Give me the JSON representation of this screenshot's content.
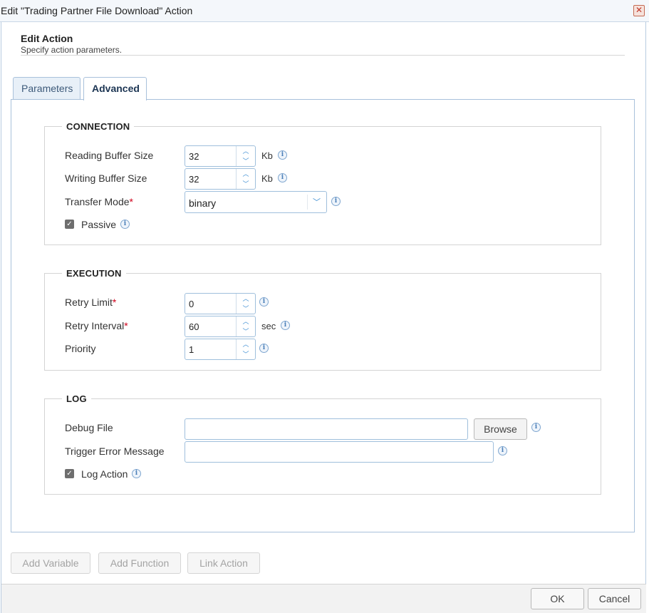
{
  "window": {
    "title": "Edit \"Trading Partner File Download\" Action",
    "close_glyph": "✕",
    "close_icon": "close-icon"
  },
  "header": {
    "title": "Edit Action",
    "subtitle": "Specify action parameters."
  },
  "tabs": [
    {
      "label": "Parameters",
      "active": false
    },
    {
      "label": "Advanced",
      "active": true
    }
  ],
  "connection": {
    "legend": "CONNECTION",
    "reading_buffer": {
      "label": "Reading Buffer Size",
      "value": "32",
      "unit": "Kb"
    },
    "writing_buffer": {
      "label": "Writing Buffer Size",
      "value": "32",
      "unit": "Kb"
    },
    "transfer_mode": {
      "label": "Transfer Mode",
      "required_mark": "*",
      "value": "binary"
    },
    "passive": {
      "label": "Passive",
      "checked": true
    }
  },
  "execution": {
    "legend": "EXECUTION",
    "retry_limit": {
      "label": "Retry Limit",
      "required_mark": "*",
      "value": "0"
    },
    "retry_interval": {
      "label": "Retry Interval",
      "required_mark": "*",
      "value": "60",
      "unit": "sec"
    },
    "priority": {
      "label": "Priority",
      "value": "1"
    }
  },
  "log": {
    "legend": "LOG",
    "debug_file": {
      "label": "Debug File",
      "value": "",
      "browse_label": "Browse"
    },
    "trigger_error": {
      "label": "Trigger Error Message",
      "value": ""
    },
    "log_action": {
      "label": "Log Action",
      "checked": true
    }
  },
  "glyphs": {
    "info": "i",
    "spin_up": "︿",
    "spin_down": "﹀",
    "check": "✓",
    "chevron_down": "﹀"
  },
  "actions": {
    "add_variable": "Add Variable",
    "add_function": "Add Function",
    "link_action": "Link Action"
  },
  "footer": {
    "ok": "OK",
    "cancel": "Cancel"
  },
  "colors": {
    "accent": "#3f8fd3",
    "border": "#9fbfdc",
    "required": "#d0021b",
    "disabled_text": "#a3a3a3"
  }
}
